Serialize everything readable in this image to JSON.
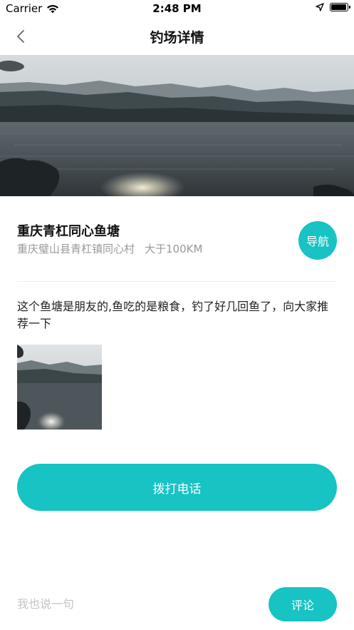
{
  "status_bar": {
    "carrier": "Carrier",
    "time": "2:48 PM",
    "battery_level": 0.95
  },
  "header": {
    "title": "钓场详情",
    "back_icon": "chevron-left-icon"
  },
  "spot": {
    "name": "重庆青杠同心鱼塘",
    "address": "重庆璧山县青杠镇同心村",
    "distance": "大于100KM",
    "nav_label": "导航"
  },
  "description": "这个鱼塘是朋友的,鱼吃的是粮食，钓了好几回鱼了，向大家推荐一下",
  "actions": {
    "call_label": "拨打电话"
  },
  "comment": {
    "placeholder": "我也说一句",
    "submit_label": "评论"
  },
  "colors": {
    "accent": "#17c3c3",
    "muted_text": "#999999",
    "divider": "#ececec"
  }
}
